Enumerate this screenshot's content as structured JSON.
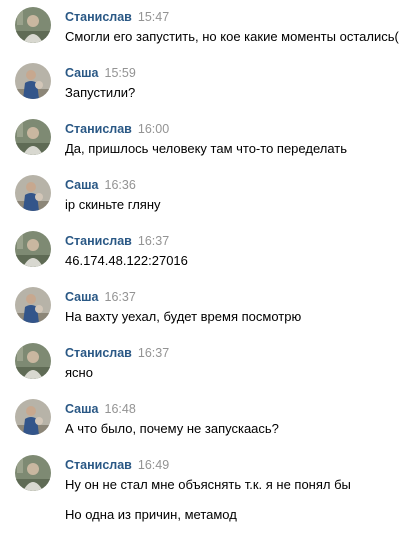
{
  "messages": [
    {
      "author": "Станислав",
      "time": "15:47",
      "text": "Смогли его запустить, но кое какие моменты остались(",
      "avatar": "stanislav-avatar"
    },
    {
      "author": "Саша",
      "time": "15:59",
      "text": "Запустили?",
      "avatar": "sasha-avatar"
    },
    {
      "author": "Станислав",
      "time": "16:00",
      "text": "Да, пришлось человеку там что-то переделать",
      "avatar": "stanislav-avatar"
    },
    {
      "author": "Саша",
      "time": "16:36",
      "text": "ip скиньте гляну",
      "avatar": "sasha-avatar"
    },
    {
      "author": "Станислав",
      "time": "16:37",
      "text": "46.174.48.122:27016",
      "avatar": "stanislav-avatar"
    },
    {
      "author": "Саша",
      "time": "16:37",
      "text": "На вахту уехал, будет время посмотрю",
      "avatar": "sasha-avatar"
    },
    {
      "author": "Станислав",
      "time": "16:37",
      "text": "ясно",
      "avatar": "stanislav-avatar"
    },
    {
      "author": "Саша",
      "time": "16:48",
      "text": "А что было, почему не запускааcь?",
      "avatar": "sasha-avatar"
    },
    {
      "author": "Станислав",
      "time": "16:49",
      "text": "Ну он не стал мне объяснять т.к. я не понял бы",
      "avatar": "stanislav-avatar"
    }
  ],
  "extra_line": "Но одна из причин, метамод",
  "colors": {
    "author": "#2a5885",
    "time": "#939393",
    "text": "#000000",
    "background": "#ffffff"
  }
}
